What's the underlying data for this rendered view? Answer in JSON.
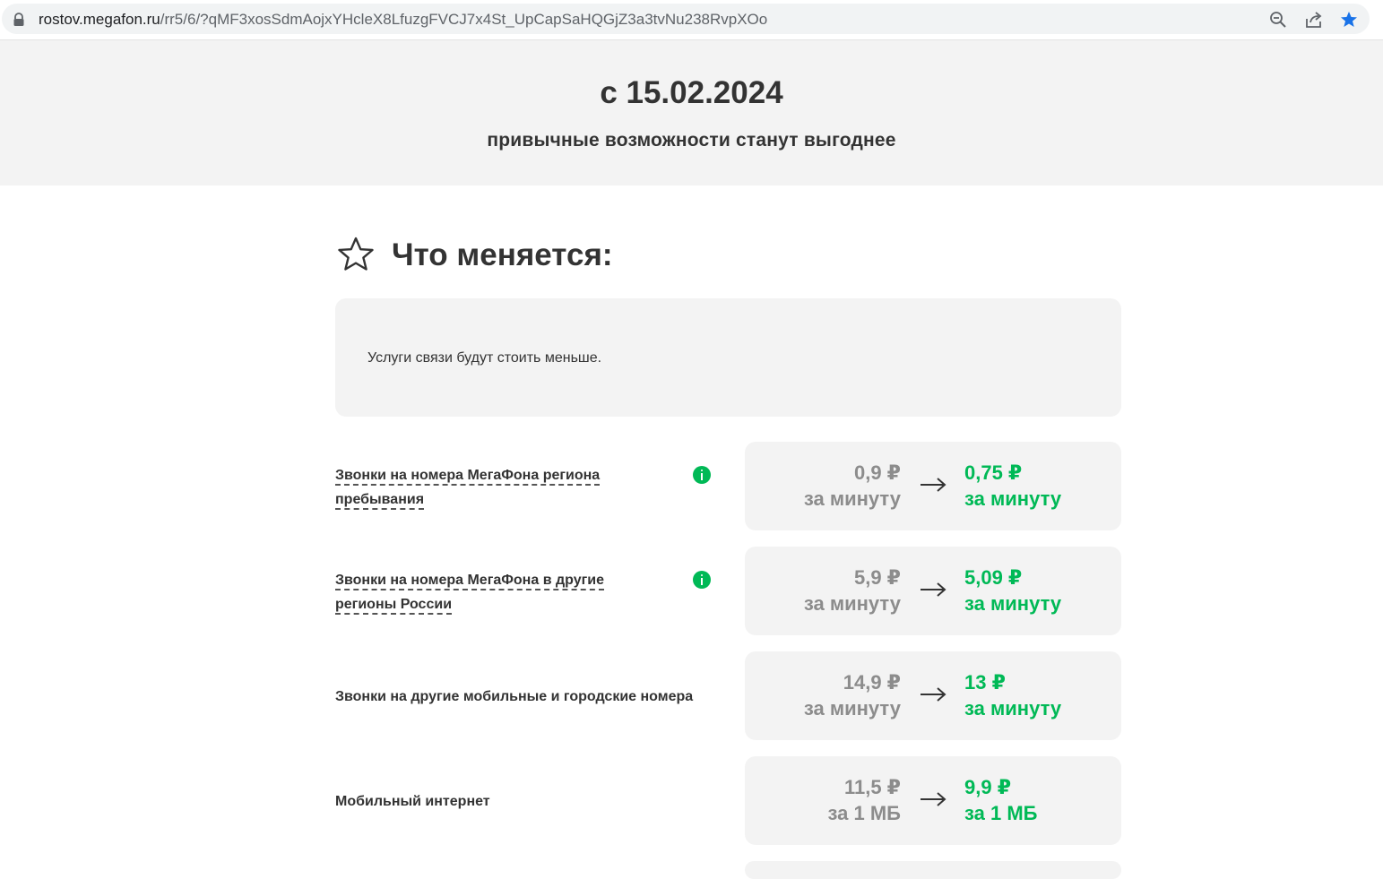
{
  "browser": {
    "url_host": "rostov.megafon.ru",
    "url_path": "/rr5/6/?qMF3xosSdmAojxYHcleX8LfuzgFVCJ7x4St_UpCapSaHQGjZ3a3tvNu238RvpXOo",
    "icons": [
      "lock-icon",
      "zoom-icon",
      "share-icon",
      "bookmark-star-icon"
    ]
  },
  "hero": {
    "title": "с 15.02.2024",
    "subtitle": "привычные возможности станут выгоднее"
  },
  "section": {
    "title": "Что меняется:",
    "notice": "Услуги связи будут стоить меньше."
  },
  "rows": [
    {
      "label": "Звонки на номера МегаФона региона пребывания",
      "has_info": true,
      "old_price": "0,9 ₽",
      "old_unit": "за минуту",
      "new_price": "0,75 ₽",
      "new_unit": "за минуту"
    },
    {
      "label": "Звонки на номера МегаФона в другие регионы России",
      "has_info": true,
      "old_price": "5,9 ₽",
      "old_unit": "за минуту",
      "new_price": "5,09 ₽",
      "new_unit": "за минуту"
    },
    {
      "label": "Звонки на другие мобильные и городские номера",
      "has_info": false,
      "old_price": "14,9 ₽",
      "old_unit": "за минуту",
      "new_price": "13 ₽",
      "new_unit": "за минуту"
    },
    {
      "label": "Мобильный интернет",
      "has_info": false,
      "old_price": "11,5 ₽",
      "old_unit": "за 1 МБ",
      "new_price": "9,9 ₽",
      "new_unit": "за 1 МБ"
    }
  ],
  "colors": {
    "accent_green": "#00b956",
    "old_price_gray": "#8c8c8c",
    "panel_bg": "#f3f3f3",
    "bookmark_blue": "#1a73e8"
  }
}
